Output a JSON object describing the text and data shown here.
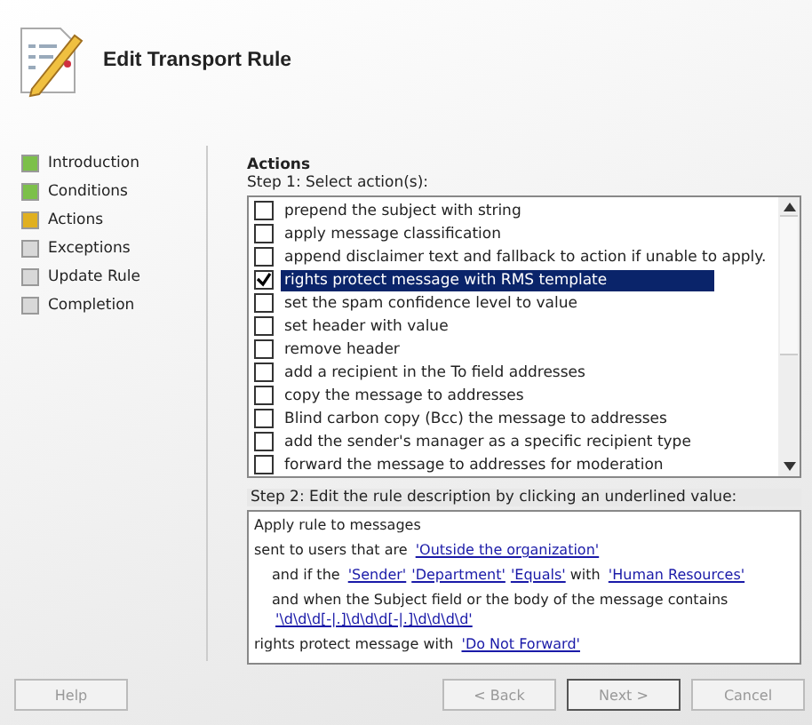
{
  "window": {
    "title": "Edit Transport Rule"
  },
  "steps": [
    {
      "label": "Introduction",
      "kind": "done"
    },
    {
      "label": "Conditions",
      "kind": "done"
    },
    {
      "label": "Actions",
      "kind": "current"
    },
    {
      "label": "Exceptions",
      "kind": "pending"
    },
    {
      "label": "Update Rule",
      "kind": "pending"
    },
    {
      "label": "Completion",
      "kind": "pending"
    }
  ],
  "section_title": "Actions",
  "step1_label": "Step 1: Select action(s):",
  "actions": [
    {
      "label": "prepend the subject with string",
      "checked": false,
      "selected": false
    },
    {
      "label": "apply message classification",
      "checked": false,
      "selected": false
    },
    {
      "label": "append disclaimer text and fallback to action if unable to apply.",
      "checked": false,
      "selected": false
    },
    {
      "label": "rights protect message with RMS template",
      "checked": true,
      "selected": true
    },
    {
      "label": "set the spam confidence level to value",
      "checked": false,
      "selected": false
    },
    {
      "label": "set header with value",
      "checked": false,
      "selected": false
    },
    {
      "label": "remove header",
      "checked": false,
      "selected": false
    },
    {
      "label": "add a recipient in the To field addresses",
      "checked": false,
      "selected": false
    },
    {
      "label": "copy the message to addresses",
      "checked": false,
      "selected": false
    },
    {
      "label": "Blind carbon copy (Bcc) the message to addresses",
      "checked": false,
      "selected": false
    },
    {
      "label": "add the sender's manager as a specific recipient type",
      "checked": false,
      "selected": false
    },
    {
      "label": "forward the message to addresses for moderation",
      "checked": false,
      "selected": false
    }
  ],
  "step2_label": "Step 2: Edit the rule description by clicking an underlined value:",
  "description": [
    {
      "indent": false,
      "parts": [
        {
          "kind": "text",
          "text": "Apply rule to messages"
        }
      ]
    },
    {
      "indent": false,
      "parts": [
        {
          "kind": "text",
          "text": "sent to users that are "
        },
        {
          "kind": "link",
          "text": "'Outside the organization'"
        }
      ]
    },
    {
      "indent": true,
      "parts": [
        {
          "kind": "text",
          "text": "and if the "
        },
        {
          "kind": "link",
          "text": "'Sender'"
        },
        {
          "kind": "link",
          "text": "'Department'"
        },
        {
          "kind": "link",
          "text": "'Equals'"
        },
        {
          "kind": "text",
          "text": " with "
        },
        {
          "kind": "link",
          "text": "'Human Resources'"
        }
      ]
    },
    {
      "indent": true,
      "parts": [
        {
          "kind": "text",
          "text": "and when the Subject field or the body of the message contains "
        },
        {
          "kind": "link",
          "text": "'\\d\\d\\d[-|.]\\d\\d\\d[-|.]\\d\\d\\d\\d'"
        }
      ]
    },
    {
      "indent": false,
      "parts": [
        {
          "kind": "text",
          "text": "rights protect message with "
        },
        {
          "kind": "link",
          "text": "'Do Not Forward'"
        }
      ]
    }
  ],
  "buttons": [
    {
      "label": "Help",
      "disabled": true,
      "default": false
    },
    {
      "label": "< Back",
      "disabled": true,
      "default": false
    },
    {
      "label": "Next >",
      "disabled": true,
      "default": true
    },
    {
      "label": "Cancel",
      "disabled": true,
      "default": false
    }
  ]
}
